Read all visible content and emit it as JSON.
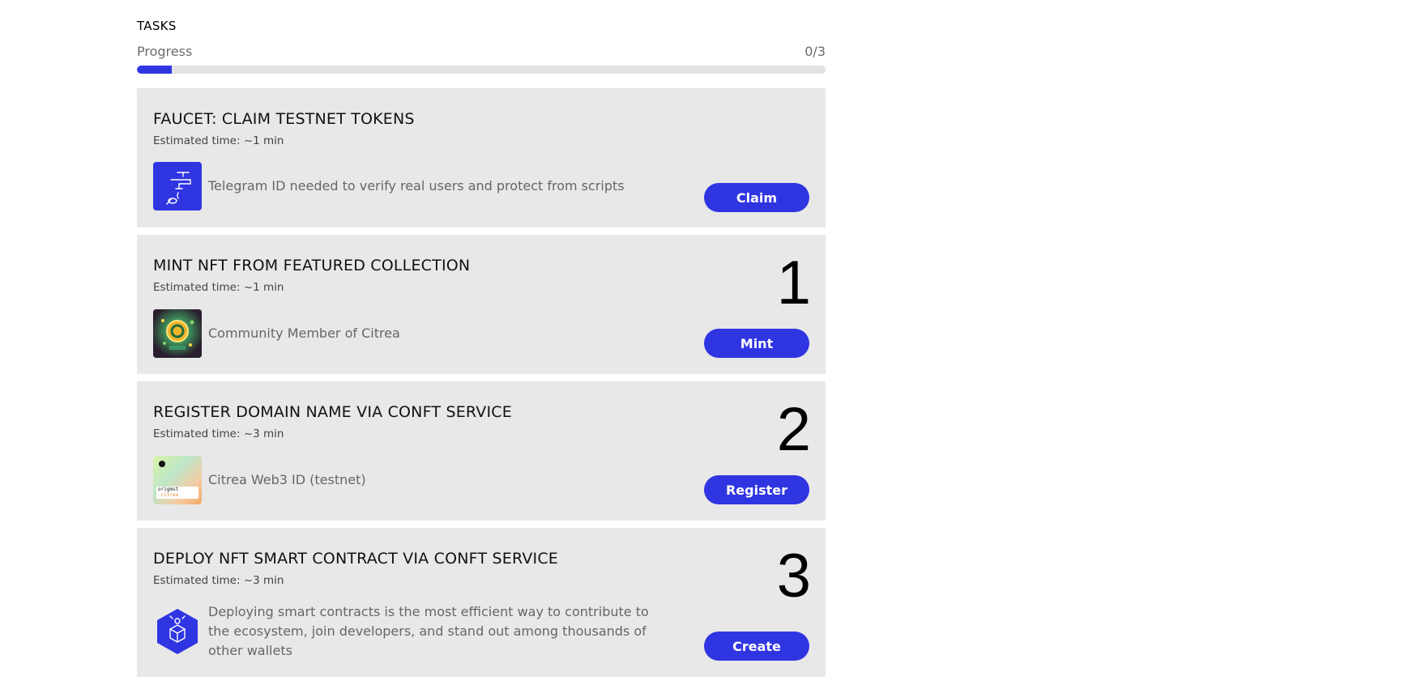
{
  "section": {
    "title": "TASKS"
  },
  "progress": {
    "label": "Progress",
    "count": "0/3",
    "fill_fraction": 0.05
  },
  "colors": {
    "accent": "#3035e2",
    "card_bg": "#e8e8e8",
    "track": "#e3e3e3"
  },
  "tasks": [
    {
      "title": "FAUCET: CLAIM TESTNET TOKENS",
      "time": "Estimated time: ~1 min",
      "description": "Telegram ID needed to verify real users and protect from scripts",
      "button": "Claim",
      "number": "",
      "icon": "faucet-icon"
    },
    {
      "title": "MINT NFT FROM FEATURED COLLECTION",
      "time": "Estimated time: ~1 min",
      "description": "Community Member of Citrea",
      "button": "Mint",
      "number": "1",
      "icon": "citrea-nft-image"
    },
    {
      "title": "REGISTER DOMAIN NAME VIA CONFT SERVICE",
      "time": "Estimated time: ~3 min",
      "description": "Citrea Web3 ID (testnet)",
      "button": "Register",
      "number": "2",
      "icon": "domain-card-image",
      "icon_text": {
        "line1": "origmst",
        "line2": ".citrea"
      }
    },
    {
      "title": "DEPLOY NFT SMART CONTRACT VIA CONFT SERVICE",
      "time": "Estimated time: ~3 min",
      "description": "Deploying smart contracts is the most efficient way to contribute to the ecosystem, join developers, and stand out among thousands of other wallets",
      "button": "Create",
      "number": "3",
      "icon": "hexagon-contract-icon"
    }
  ]
}
